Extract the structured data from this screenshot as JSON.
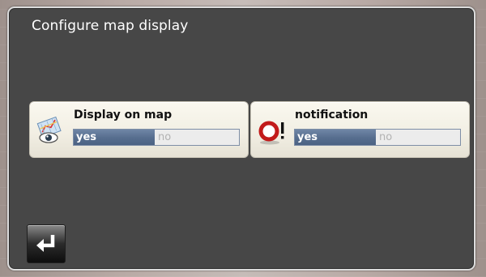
{
  "screen": {
    "title": "Configure map display"
  },
  "settings": [
    {
      "label": "Display on map",
      "icon": "map-eye-icon",
      "options": {
        "yes": "yes",
        "no": "no"
      },
      "selected": "yes"
    },
    {
      "label": "notification",
      "icon": "warning-ring-icon",
      "options": {
        "yes": "yes",
        "no": "no"
      },
      "selected": "yes"
    }
  ],
  "footer": {
    "back_icon": "return-arrow-icon"
  },
  "colors": {
    "frame_background": "#474747",
    "selected_option": "#566d8e",
    "warning_red": "#c21a1a"
  }
}
